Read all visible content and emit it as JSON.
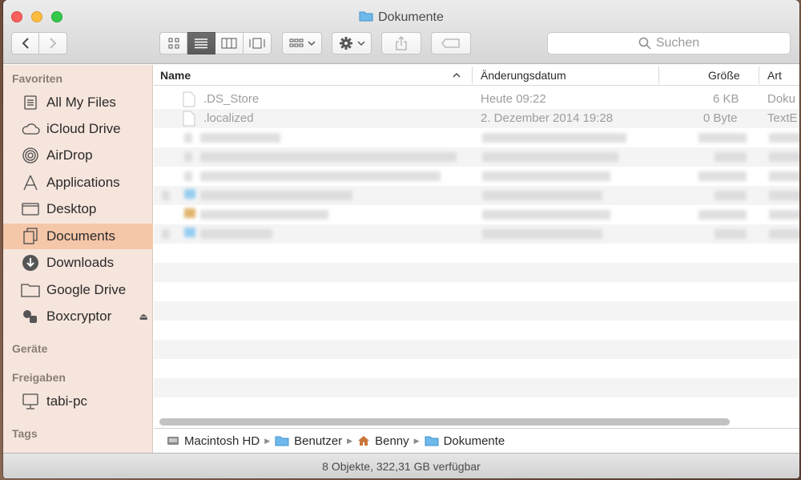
{
  "window": {
    "title": "Dokumente"
  },
  "toolbar": {
    "back": "back",
    "forward": "forward",
    "view_icons": "icon-view",
    "view_list": "list-view",
    "view_columns": "column-view",
    "view_coverflow": "coverflow-view",
    "arrange": "arrange",
    "action": "action",
    "share": "share",
    "tags": "tags",
    "search_placeholder": "Suchen"
  },
  "sidebar": {
    "favorites_header": "Favoriten",
    "favorites": [
      {
        "label": "All My Files",
        "icon": "all-files-icon"
      },
      {
        "label": "iCloud Drive",
        "icon": "cloud-icon"
      },
      {
        "label": "AirDrop",
        "icon": "airdrop-icon"
      },
      {
        "label": "Applications",
        "icon": "applications-icon"
      },
      {
        "label": "Desktop",
        "icon": "desktop-icon"
      },
      {
        "label": "Documents",
        "icon": "documents-icon",
        "selected": true
      },
      {
        "label": "Downloads",
        "icon": "downloads-icon"
      },
      {
        "label": "Google Drive",
        "icon": "folder-icon"
      },
      {
        "label": "Boxcryptor",
        "icon": "boxcryptor-icon"
      }
    ],
    "devices_header": "Geräte",
    "shared_header": "Freigaben",
    "shared": [
      {
        "label": "tabi-pc",
        "icon": "computer-icon"
      }
    ],
    "tags_header": "Tags"
  },
  "columns": {
    "name": "Name",
    "date": "Änderungsdatum",
    "size": "Größe",
    "kind": "Art"
  },
  "files": [
    {
      "name": ".DS_Store",
      "date": "Heute 09:22",
      "size": "6 KB",
      "kind": "Doku"
    },
    {
      "name": ".localized",
      "date": "2. Dezember 2014 19:28",
      "size": "0 Byte",
      "kind": "TextE"
    }
  ],
  "pathbar": [
    "Macintosh HD",
    "Benutzer",
    "Benny",
    "Dokumente"
  ],
  "status": "8 Objekte, 322,31 GB verfügbar"
}
